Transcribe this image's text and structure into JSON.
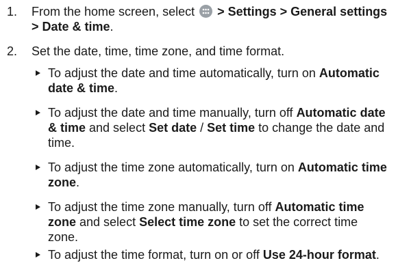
{
  "steps": [
    {
      "number": "1.",
      "pre_icon_text": "From the home screen, select ",
      "icon": "apps-icon",
      "path_bold": " > Settings > General settings > Date & time",
      "end": "."
    },
    {
      "number": "2.",
      "text": "Set the date, time, time zone, and time format."
    }
  ],
  "bullets": [
    {
      "t1": "To adjust the date and time automatically, turn on ",
      "b1": "Automatic date & time",
      "end": "."
    },
    {
      "t1": "To adjust the date and time manually, turn off ",
      "b1": "Automatic date & time",
      "t2": " and select ",
      "b2": "Set date",
      "t3": " / ",
      "b3": "Set time",
      "end": " to change the date and time."
    },
    {
      "t1": "To adjust the time zone automatically, turn on ",
      "b1": "Automatic time zone",
      "end": "."
    },
    {
      "t1": "To adjust the time zone manually, turn off ",
      "b1": "Automatic time zone",
      "t2": " and select ",
      "b2": "Select time zone",
      "end": " to set the correct time zone."
    },
    {
      "t1": "To adjust the time format, turn on or off ",
      "b1": "Use 24-hour format",
      "end": "."
    }
  ]
}
